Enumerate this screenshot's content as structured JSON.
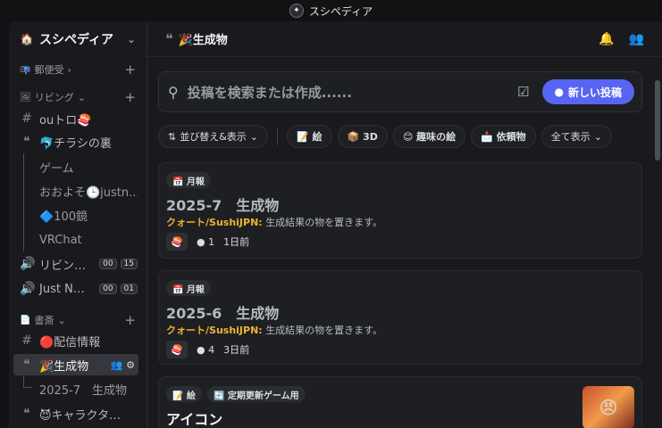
{
  "window": {
    "title": "スシペディア"
  },
  "server": {
    "name": "スシペディア",
    "icon": "🏠"
  },
  "sidebar": {
    "categories": [
      {
        "label": "郵便受",
        "emoji": "📭",
        "chevron": "›"
      },
      {
        "label": "リビング",
        "emoji": "🖼",
        "chevron": "⌄"
      },
      {
        "label": "書斎",
        "emoji": "📄",
        "chevron": "⌄"
      }
    ],
    "channels": [
      {
        "label": "ouトロ🍣",
        "icon": "#"
      },
      {
        "label": "🐬チラシの裏",
        "icon": "forum"
      },
      {
        "label": "ゲーム"
      },
      {
        "label": "おおよそ🕒justn..."
      },
      {
        "label": "🔷100鏡"
      },
      {
        "label": "VRChat"
      },
      {
        "label": "リビン…",
        "badges": [
          "00",
          "15"
        ]
      },
      {
        "label": "Just N…",
        "badges": [
          "00",
          "01"
        ]
      },
      {
        "label": "🔴配信情報",
        "icon": "#"
      },
      {
        "label": "🎉生成物",
        "icon": "forum"
      },
      {
        "label": "2025-7　生成物"
      },
      {
        "label": "😈キャラクタ…",
        "icon": "forum"
      }
    ]
  },
  "header": {
    "title": "🎉生成物"
  },
  "search": {
    "placeholder": "投稿を検索または作成......",
    "new_post_label": "新しい投稿"
  },
  "filters": {
    "sort_label": "並び替え&表示",
    "tags": [
      "📝 絵",
      "📦 3D",
      "😊 趣味の絵",
      "📩 依頼物"
    ],
    "show_all": "全て表示"
  },
  "posts": [
    {
      "tags": [
        "📅 月報"
      ],
      "title": "2025-7　生成物",
      "author": "クォート/SushiJPN:",
      "snippet": "生成結果の物を置きます。",
      "replies": "1",
      "time": "1日前"
    },
    {
      "tags": [
        "📅 月報"
      ],
      "title": "2025-6　生成物",
      "author": "クォート/SushiJPN:",
      "snippet": "生成結果の物を置きます。",
      "replies": "4",
      "time": "3日前"
    },
    {
      "tags": [
        "📝 絵",
        "🔄 定期更新ゲーム用"
      ],
      "title": "アイコン"
    }
  ],
  "colors": {
    "accent": "#5865f2",
    "author": "#f0b232",
    "background": "#1a1a1e"
  }
}
